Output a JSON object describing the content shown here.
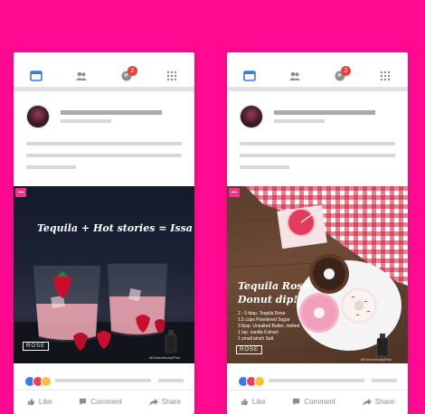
{
  "colors": {
    "background": "#ff0a90",
    "badge": "#e8403f",
    "nav_icon_active": "#3b7be8",
    "nav_icon": "#8a8d91"
  },
  "nav": {
    "items": [
      "home-feed-icon",
      "friends-icon",
      "notifications-globe-icon",
      "menu-grid-icon"
    ],
    "notification_count": "2"
  },
  "posts": [
    {
      "image": {
        "headline": "Tequila + Hot stories = Issa Plot",
        "brand_mark": "ROSE",
        "hashtag": "#ExtraordinaryPlan"
      },
      "reactions": [
        "like",
        "love",
        "haha"
      ],
      "actions": {
        "like": "Like",
        "comment": "Comment",
        "share": "Share"
      }
    },
    {
      "image": {
        "headline_line1": "Tequila Rose",
        "headline_line2": "Donut dip!",
        "recipe": [
          "2 - 5 tbsp. Tequila Rose",
          "1.5 cups Powdered Sugar",
          "3 tbsp. Unsalted Butter, melted",
          "1 tsp. vanilla Extract",
          "1 small pinch Salt"
        ],
        "brand_mark": "ROSE",
        "hashtag": "#ExtraordinaryPlan"
      },
      "reactions": [
        "like",
        "love",
        "haha"
      ],
      "actions": {
        "like": "Like",
        "comment": "Comment",
        "share": "Share"
      }
    }
  ]
}
